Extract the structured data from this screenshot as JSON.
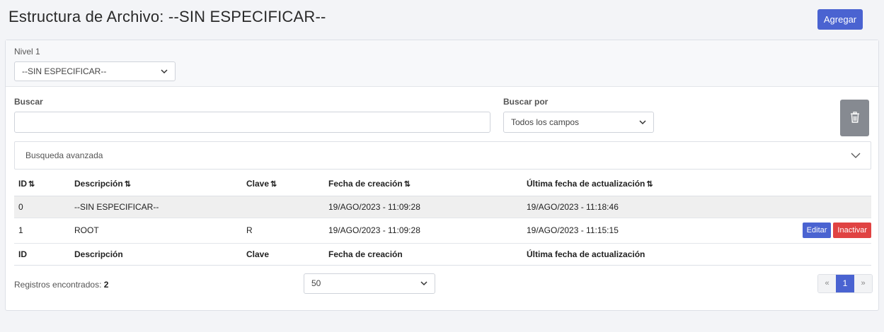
{
  "header": {
    "title": "Estructura de Archivo: --SIN ESPECIFICAR--",
    "add_label": "Agregar"
  },
  "level": {
    "label": "Nivel 1",
    "selected": "--SIN ESPECIFICAR--"
  },
  "search": {
    "label": "Buscar",
    "value": "",
    "by_label": "Buscar por",
    "by_selected": "Todos los campos"
  },
  "advanced": {
    "label": "Busqueda avanzada"
  },
  "table": {
    "headers": [
      "ID",
      "Descripción",
      "Clave",
      "Fecha de creación",
      "Última fecha de actualización"
    ],
    "sort_glyph": "⇅",
    "rows": [
      {
        "id": "0",
        "descripcion": "--SIN ESPECIFICAR--",
        "clave": "",
        "creacion": "19/AGO/2023 - 11:09:28",
        "actualizacion": "19/AGO/2023 - 11:18:46"
      },
      {
        "id": "1",
        "descripcion": "ROOT",
        "clave": "R",
        "creacion": "19/AGO/2023 - 11:09:28",
        "actualizacion": "19/AGO/2023 - 11:15:15",
        "edit_label": "Editar",
        "inactivate_label": "Inactivar"
      }
    ]
  },
  "footer": {
    "records_label": "Registros encontrados:",
    "records_count": "2",
    "page_size": "50",
    "pager": {
      "prev": "«",
      "current": "1",
      "next": "»"
    }
  },
  "colors": {
    "primary": "#4a63d1",
    "danger": "#e04343",
    "secondary": "#868a91"
  },
  "icons": {
    "trash": "trash-icon",
    "chevron": "chevron-down-icon"
  }
}
